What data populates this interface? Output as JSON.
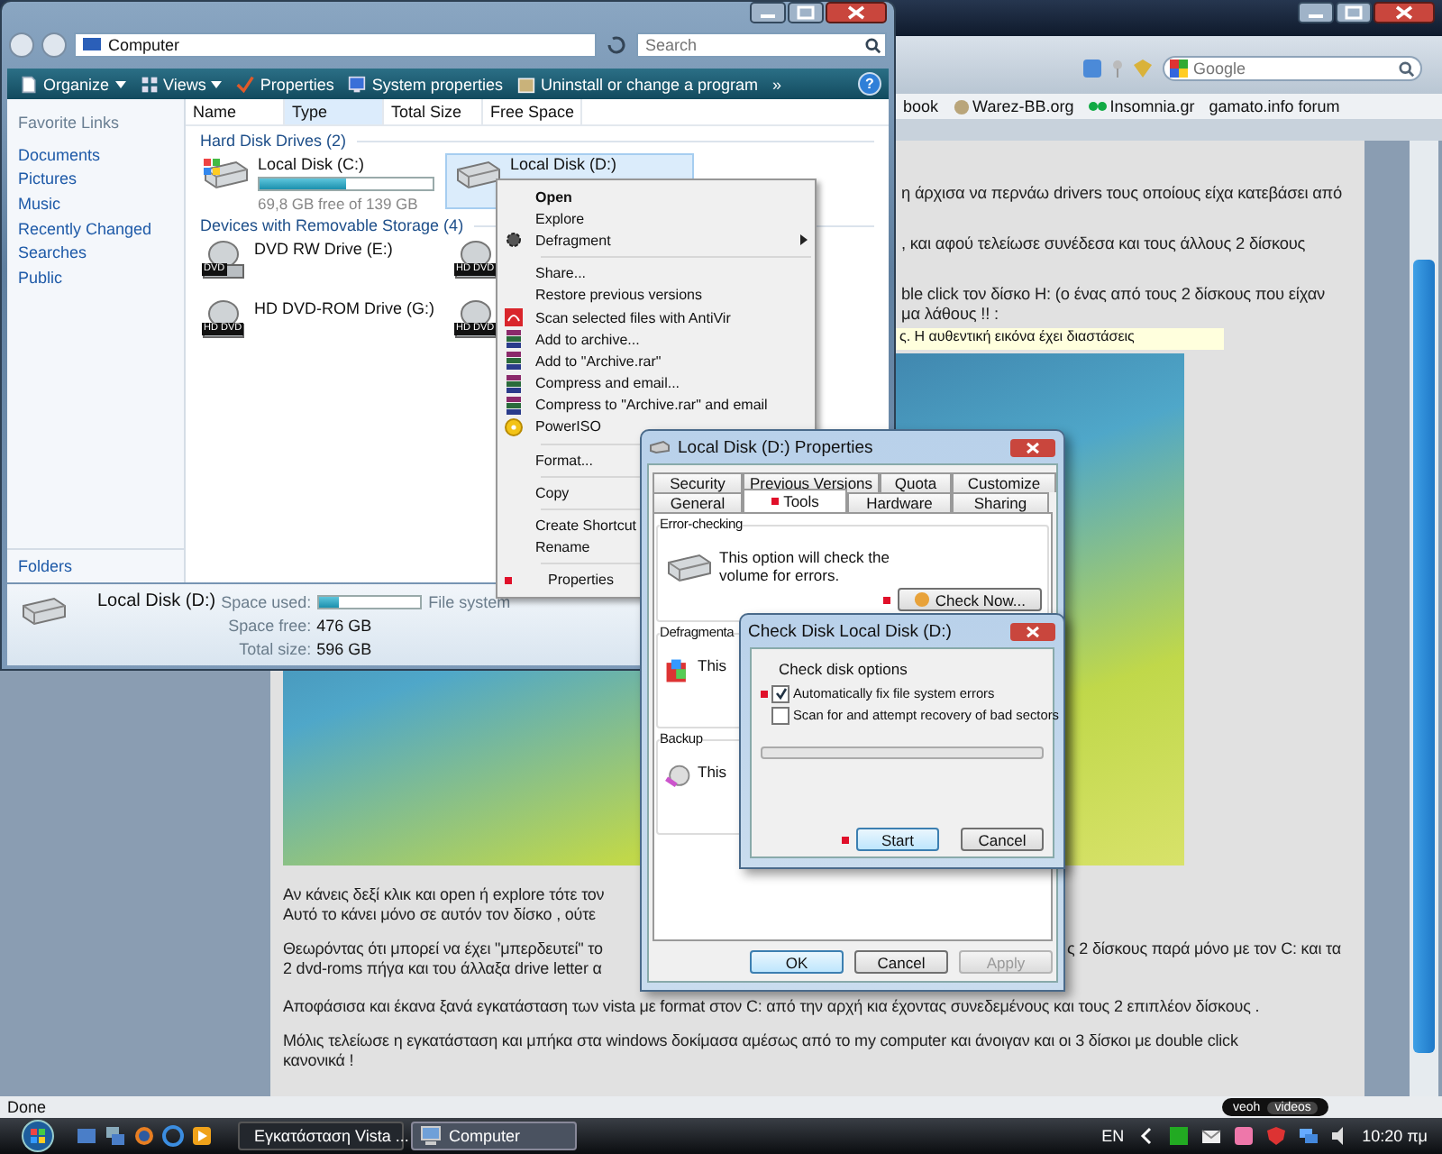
{
  "browser": {
    "search_placeholder": "Google",
    "bookmarks": [
      {
        "label": "book",
        "kind": "plain"
      },
      {
        "label": "Warez-BB.org",
        "kind": "globe"
      },
      {
        "label": "Insomnia.gr",
        "kind": "eyes"
      },
      {
        "label": "gamato.info forum",
        "kind": "plain"
      }
    ],
    "page_lines": [
      "η άρχισα να περνάω drivers τους οποίους είχα κατεβάσει από",
      ", και αφού τελείωσε συνέδεσα και τους άλλους 2 δίσκους",
      "ble click τον δίσκο H: (ο ένας από τους 2 δίσκους που είχαν",
      "μα λάθους !! :",
      "Αν κάνεις δεξί κλικ και open ή explore τότε τον",
      "Αυτό το κάνει μόνο σε αυτόν τον δίσκο , ούτε",
      "Θεωρόντας ότι μπορεί να έχει \"μπερδευτεί\" το",
      "ς 2 δίσκους παρά μόνο με τον C: και τα",
      "2 dvd-roms πήγα και του άλλαξα drive letter α",
      "Αποφάσισα και έκανα ξανά εγκατάσταση των vista με format στον C: από την αρχή κια έχοντας συνεδεμένους και τους 2 επιπλέον δίσκους .",
      "Μόλις τελείωσε η εγκατάσταση και μπήκα στα windows δοκίμασα αμέσως από το my computer και άνοιγαν και οι 3 δίσκοι με double click",
      "κανονικά !"
    ],
    "image_caption": "ς. Η αυθεντική εικόνα έχει διαστάσεις",
    "status": "Done",
    "badge": [
      "veoh",
      "videos"
    ]
  },
  "explorer": {
    "address": "Computer",
    "search_placeholder": "Search",
    "help": "?",
    "toolbar": [
      {
        "label": "Organize",
        "kind": "organize"
      },
      {
        "label": "Views",
        "kind": "views"
      },
      {
        "label": "Properties",
        "kind": "properties"
      },
      {
        "label": "System properties",
        "kind": "system"
      },
      {
        "label": "Uninstall or change a program",
        "kind": "uninstall"
      },
      {
        "label": "»",
        "kind": "more"
      }
    ],
    "favorites_title": "Favorite Links",
    "favorites": [
      "Documents",
      "Pictures",
      "Music",
      "Recently Changed",
      "Searches",
      "Public"
    ],
    "folders": "Folders",
    "columns": [
      {
        "label": "Name",
        "sorted": false
      },
      {
        "label": "Type",
        "sorted": true
      },
      {
        "label": "Total Size",
        "sorted": false
      },
      {
        "label": "Free Space",
        "sorted": false
      }
    ],
    "groups": [
      {
        "title": "Hard Disk Drives (2)",
        "items": [
          {
            "kind": "system",
            "label": "Local Disk (C:)",
            "level": 0.5,
            "free": "69,8 GB free of 139 GB",
            "selected": false
          },
          {
            "kind": "hdd",
            "label": "Local Disk (D:)",
            "selected": true
          }
        ]
      },
      {
        "title": "Devices with Removable Storage (4)",
        "items": [
          {
            "kind": "disc",
            "badge": "DVD",
            "label": "DVD RW Drive (E:)",
            "selected": false
          },
          {
            "kind": "disc",
            "badge": "HD DVD",
            "selected": false
          },
          {
            "kind": "disc",
            "badge": "HD DVD",
            "label": "HD DVD-ROM Drive (G:)",
            "selected": false
          },
          {
            "kind": "disc",
            "badge": "HD DVD",
            "selected": false
          }
        ]
      }
    ],
    "details": {
      "name": "Local Disk (D:)",
      "used_label": "Space used:",
      "level": 0.2,
      "fs_label": "File system",
      "free_label": "Space free:",
      "free": "476 GB",
      "total_label": "Total size:",
      "total": "596 GB"
    }
  },
  "context_menu": [
    {
      "kind": "plain",
      "label": "Open",
      "bold": true,
      "submenu": false,
      "marked": false
    },
    {
      "kind": "plain",
      "label": "Explore",
      "bold": false,
      "submenu": false,
      "marked": false
    },
    {
      "kind": "defrag",
      "label": "Defragment",
      "bold": false,
      "submenu": true,
      "marked": false
    },
    {
      "kind": "separator"
    },
    {
      "kind": "plain",
      "label": "Share...",
      "bold": false,
      "submenu": false,
      "marked": false
    },
    {
      "kind": "plain",
      "label": "Restore previous versions",
      "bold": false,
      "submenu": false,
      "marked": false
    },
    {
      "kind": "antivir",
      "label": "Scan selected files with AntiVir",
      "bold": false,
      "submenu": false,
      "marked": false
    },
    {
      "kind": "archive",
      "label": "Add to archive...",
      "bold": false,
      "submenu": false,
      "marked": false
    },
    {
      "kind": "archive",
      "label": "Add to \"Archive.rar\"",
      "bold": false,
      "submenu": false,
      "marked": false
    },
    {
      "kind": "archive",
      "label": "Compress and email...",
      "bold": false,
      "submenu": false,
      "marked": false
    },
    {
      "kind": "archive",
      "label": "Compress to \"Archive.rar\" and email",
      "bold": false,
      "submenu": false,
      "marked": false
    },
    {
      "kind": "iso",
      "label": "PowerISO",
      "bold": false,
      "marked": false
    },
    {
      "kind": "separator"
    },
    {
      "kind": "plain",
      "label": "Format...",
      "bold": false,
      "marked": false
    },
    {
      "kind": "separator"
    },
    {
      "kind": "plain",
      "label": "Copy",
      "bold": false,
      "marked": false
    },
    {
      "kind": "separator"
    },
    {
      "kind": "plain",
      "label": "Create Shortcut",
      "bold": false,
      "marked": false
    },
    {
      "kind": "plain",
      "label": "Rename",
      "bold": false,
      "marked": false
    },
    {
      "kind": "separator"
    },
    {
      "kind": "plain",
      "label": "Properties",
      "bold": false,
      "marked": true
    }
  ],
  "properties": {
    "title": "Local Disk (D:) Properties",
    "tab_rows": [
      [
        {
          "label": "Security",
          "selected": false,
          "marked": false
        },
        {
          "label": "Previous Versions",
          "selected": false,
          "marked": false
        },
        {
          "label": "Quota",
          "selected": false,
          "marked": false
        },
        {
          "label": "Customize",
          "selected": false,
          "marked": false
        }
      ],
      [
        {
          "label": "General",
          "selected": false,
          "marked": false
        },
        {
          "label": "Tools",
          "selected": true,
          "marked": true
        },
        {
          "label": "Hardware",
          "selected": false,
          "marked": false
        },
        {
          "label": "Sharing",
          "selected": false,
          "marked": false
        }
      ]
    ],
    "groups": [
      {
        "kind": "check",
        "title": "Error-checking",
        "text": "This option will check the volume for errors.",
        "button": {
          "label": "Check Now...",
          "marked": true
        }
      },
      {
        "kind": "defrag",
        "title": "Defragmenta",
        "text": "This"
      },
      {
        "kind": "backup",
        "title": "Backup",
        "text": "This"
      }
    ],
    "buttons": [
      {
        "label": "OK",
        "disabled": false
      },
      {
        "label": "Cancel",
        "disabled": false
      },
      {
        "label": "Apply",
        "disabled": true
      }
    ]
  },
  "check_disk": {
    "title": "Check Disk Local Disk (D:)",
    "group": "Check disk options",
    "options": [
      {
        "label": "Automatically fix file system errors",
        "checked": true,
        "marked": true
      },
      {
        "label": "Scan for and attempt recovery of bad sectors",
        "checked": false,
        "marked": false
      }
    ],
    "progress": {
      "level": 0
    },
    "buttons": [
      {
        "label": "Start",
        "marked": true
      },
      {
        "label": "Cancel",
        "marked": false
      }
    ]
  },
  "taskbar": {
    "tasks": [
      {
        "label": "Εγκατάσταση Vista ...",
        "kind": "firefox",
        "selected": false
      },
      {
        "label": "Computer",
        "kind": "computer",
        "selected": true
      }
    ],
    "language": "EN",
    "clock": "10:20 πμ"
  }
}
